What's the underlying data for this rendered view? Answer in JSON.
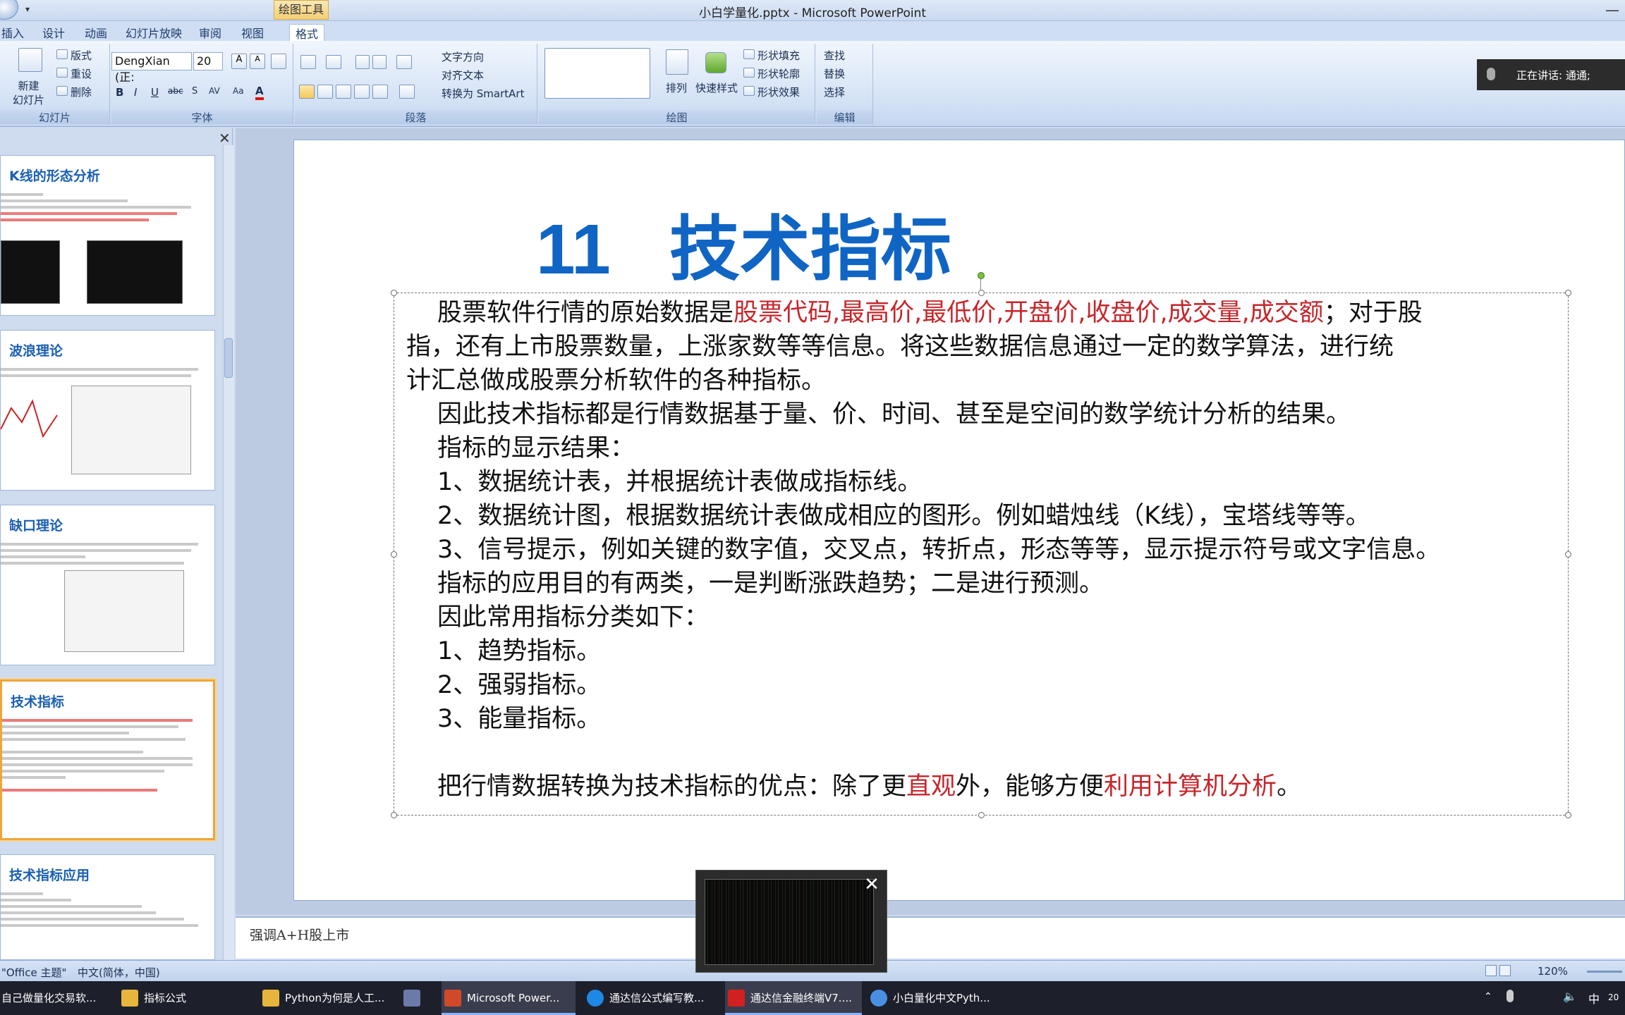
{
  "window": {
    "title": "小白学量化.pptx - Microsoft PowerPoint",
    "drawing_tools": "绘图工具"
  },
  "tabs": [
    "插入",
    "设计",
    "动画",
    "幻灯片放映",
    "审阅",
    "视图",
    "格式"
  ],
  "ribbon": {
    "slides": {
      "new_slide": "新建\n幻灯片",
      "layout": "版式",
      "reset": "重设",
      "delete": "删除",
      "label": "幻灯片"
    },
    "font": {
      "name": "DengXian (正:",
      "size": "20",
      "label": "字体"
    },
    "paragraph": {
      "text_dir": "文字方向",
      "align_text": "对齐文本",
      "smartart": "转换为 SmartArt",
      "label": "段落"
    },
    "drawing": {
      "arrange": "排列",
      "quick_styles": "快速样式",
      "fill": "形状填充",
      "outline": "形状轮廓",
      "effects": "形状效果",
      "label": "绘图"
    },
    "editing": {
      "find": "查找",
      "replace": "替换",
      "select": "选择",
      "label": "编辑"
    }
  },
  "speaking": "正在讲话: 通通;",
  "thumbnails": [
    {
      "title": "K线的形态分析"
    },
    {
      "title": "波浪理论"
    },
    {
      "title": "缺口理论"
    },
    {
      "title": "技术指标"
    },
    {
      "title": "技术指标应用"
    }
  ],
  "slide": {
    "title": "11   技术指标",
    "para1_a": "股票软件行情的原始数据是",
    "para1_red": "股票代码,最高价,最低价,开盘价,收盘价,成交量,成交额",
    "para1_b": "；对于股",
    "para1_line2": "指，还有上市股票数量，上涨家数等等信息。将这些数据信息通过一定的数学算法，进行统",
    "para1_line3": "计汇总做成股票分析软件的各种指标。",
    "para2": "因此技术指标都是行情数据基于量、价、时间、甚至是空间的数学统计分析的结果。",
    "para3": "指标的显示结果：",
    "item1": "1、数据统计表，并根据统计表做成指标线。",
    "item2": "2、数据统计图，根据数据统计表做成相应的图形。例如蜡烛线（K线），宝塔线等等。",
    "item3": "3、信号提示，例如关键的数字值，交叉点，转折点，形态等等，显示提示符号或文字信息。",
    "para4": "指标的应用目的有两类，一是判断涨跌趋势；二是进行预测。",
    "para5": "因此常用指标分类如下：",
    "cls1": "1、趋势指标。",
    "cls2": "2、强弱指标。",
    "cls3": "3、能量指标。",
    "last_a": "把行情数据转换为技术指标的优点：除了更",
    "last_red1": "直观",
    "last_b": "外，能够方便",
    "last_red2": "利用计算机分析",
    "last_c": "。"
  },
  "notes": "强调A+H股上市",
  "status": {
    "theme": "\"Office 主题\"",
    "lang": "中文(简体，中国)",
    "zoom": "120%"
  },
  "taskbar": [
    {
      "label": "自己做量化交易软...",
      "color": "#2b2b2b"
    },
    {
      "label": "指标公式",
      "color": "#e7b53c"
    },
    {
      "label": "Python为何是人工...",
      "color": "#e7b53c"
    },
    {
      "label": "",
      "color": "#6b7aa8"
    },
    {
      "label": "Microsoft Power...",
      "color": "#d04a2a"
    },
    {
      "label": "通达信公式编写教...",
      "color": "#1e88e5"
    },
    {
      "label": "通达信金融终端V7....",
      "color": "#d21f1f"
    },
    {
      "label": "小白量化中文Pyth...",
      "color": "#4a90e2"
    }
  ],
  "tray": {
    "ime": "中",
    "time": "20"
  }
}
